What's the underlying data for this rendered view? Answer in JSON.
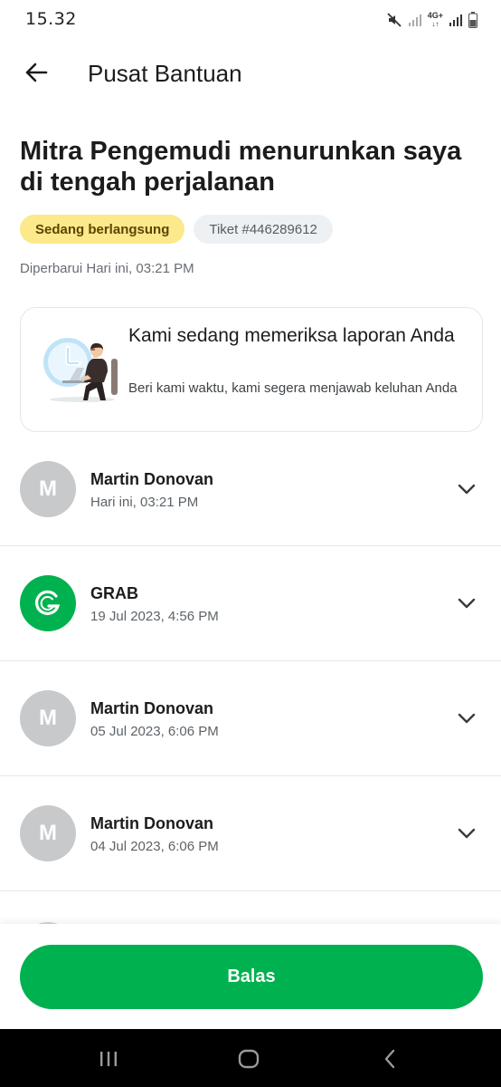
{
  "status_bar": {
    "time": "15.32",
    "network_label": "4G+",
    "icons": [
      "mute-icon",
      "signal-icon",
      "network-4g-icon",
      "signal-icon",
      "battery-icon"
    ]
  },
  "app_bar": {
    "back_icon": "arrow-left-icon",
    "title": "Pusat Bantuan"
  },
  "ticket": {
    "title": "Mitra Pengemudi menurunkan saya di tengah perjalanan",
    "status": "Sedang berlangsung",
    "ticket_id": "Tiket #446289612",
    "updated": "Diperbarui Hari ini, 03:21 PM"
  },
  "review_card": {
    "title": "Kami sedang memeriksa laporan Anda",
    "description": "Beri kami waktu, kami segera menjawab keluhan Anda",
    "illustration": "clock-agent-illustration"
  },
  "messages": [
    {
      "initial": "M",
      "sender": "Martin Donovan",
      "time": "Hari ini, 03:21 PM"
    },
    {
      "initial": "G",
      "sender": "GRAB",
      "time": "19 Jul 2023, 4:56 PM"
    },
    {
      "initial": "M",
      "sender": "Martin Donovan",
      "time": "05 Jul 2023, 6:06 PM"
    },
    {
      "initial": "M",
      "sender": "Martin Donovan",
      "time": "04 Jul 2023, 6:06 PM"
    }
  ],
  "reply_button": "Balas",
  "nav_bar": {
    "icons": [
      "recent-apps-icon",
      "home-icon",
      "back-nav-icon"
    ]
  },
  "colors": {
    "brand_green": "#00b14f",
    "status_badge_bg": "#fbe98c",
    "avatar_grey": "#c7c9cb"
  }
}
